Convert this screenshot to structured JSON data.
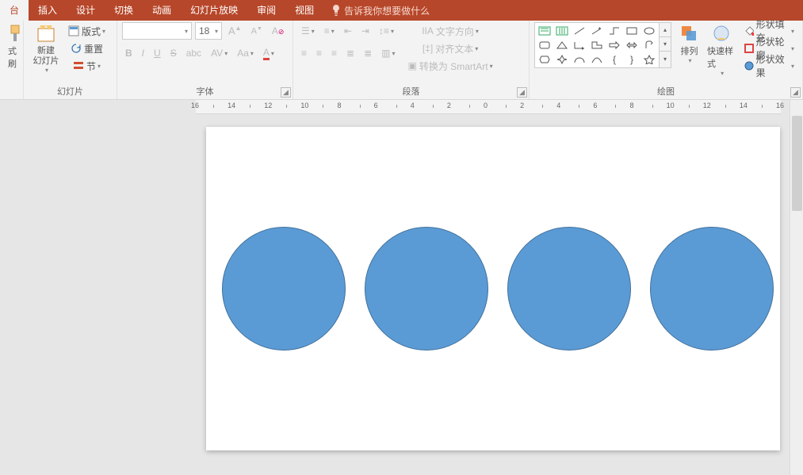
{
  "tabs": {
    "active": "台",
    "items": [
      "插入",
      "设计",
      "切换",
      "动画",
      "幻灯片放映",
      "审阅",
      "视图"
    ],
    "tell_me": "告诉我你想要做什么"
  },
  "groups": {
    "clipboard": {
      "brush": "式刷"
    },
    "slides": {
      "new_slide": "新建\n幻灯片",
      "layout": "版式",
      "reset": "重置",
      "section": "节",
      "label": "幻灯片"
    },
    "font": {
      "size": "18",
      "label": "字体"
    },
    "paragraph": {
      "text_direction": "文字方向",
      "align_text": "对齐文本",
      "convert_smartart": "转换为 SmartArt",
      "label": "段落"
    },
    "drawing": {
      "arrange": "排列",
      "quick_styles": "快速样式",
      "shape_fill": "形状填充",
      "shape_outline": "形状轮廓",
      "shape_effects": "形状效果",
      "label": "绘图"
    }
  },
  "ruler": {
    "marks": [
      "16",
      "14",
      "12",
      "10",
      "8",
      "6",
      "4",
      "2",
      "0",
      "2",
      "4",
      "6",
      "8",
      "10",
      "12",
      "14",
      "16"
    ]
  },
  "slide": {
    "circle_count": 4
  }
}
